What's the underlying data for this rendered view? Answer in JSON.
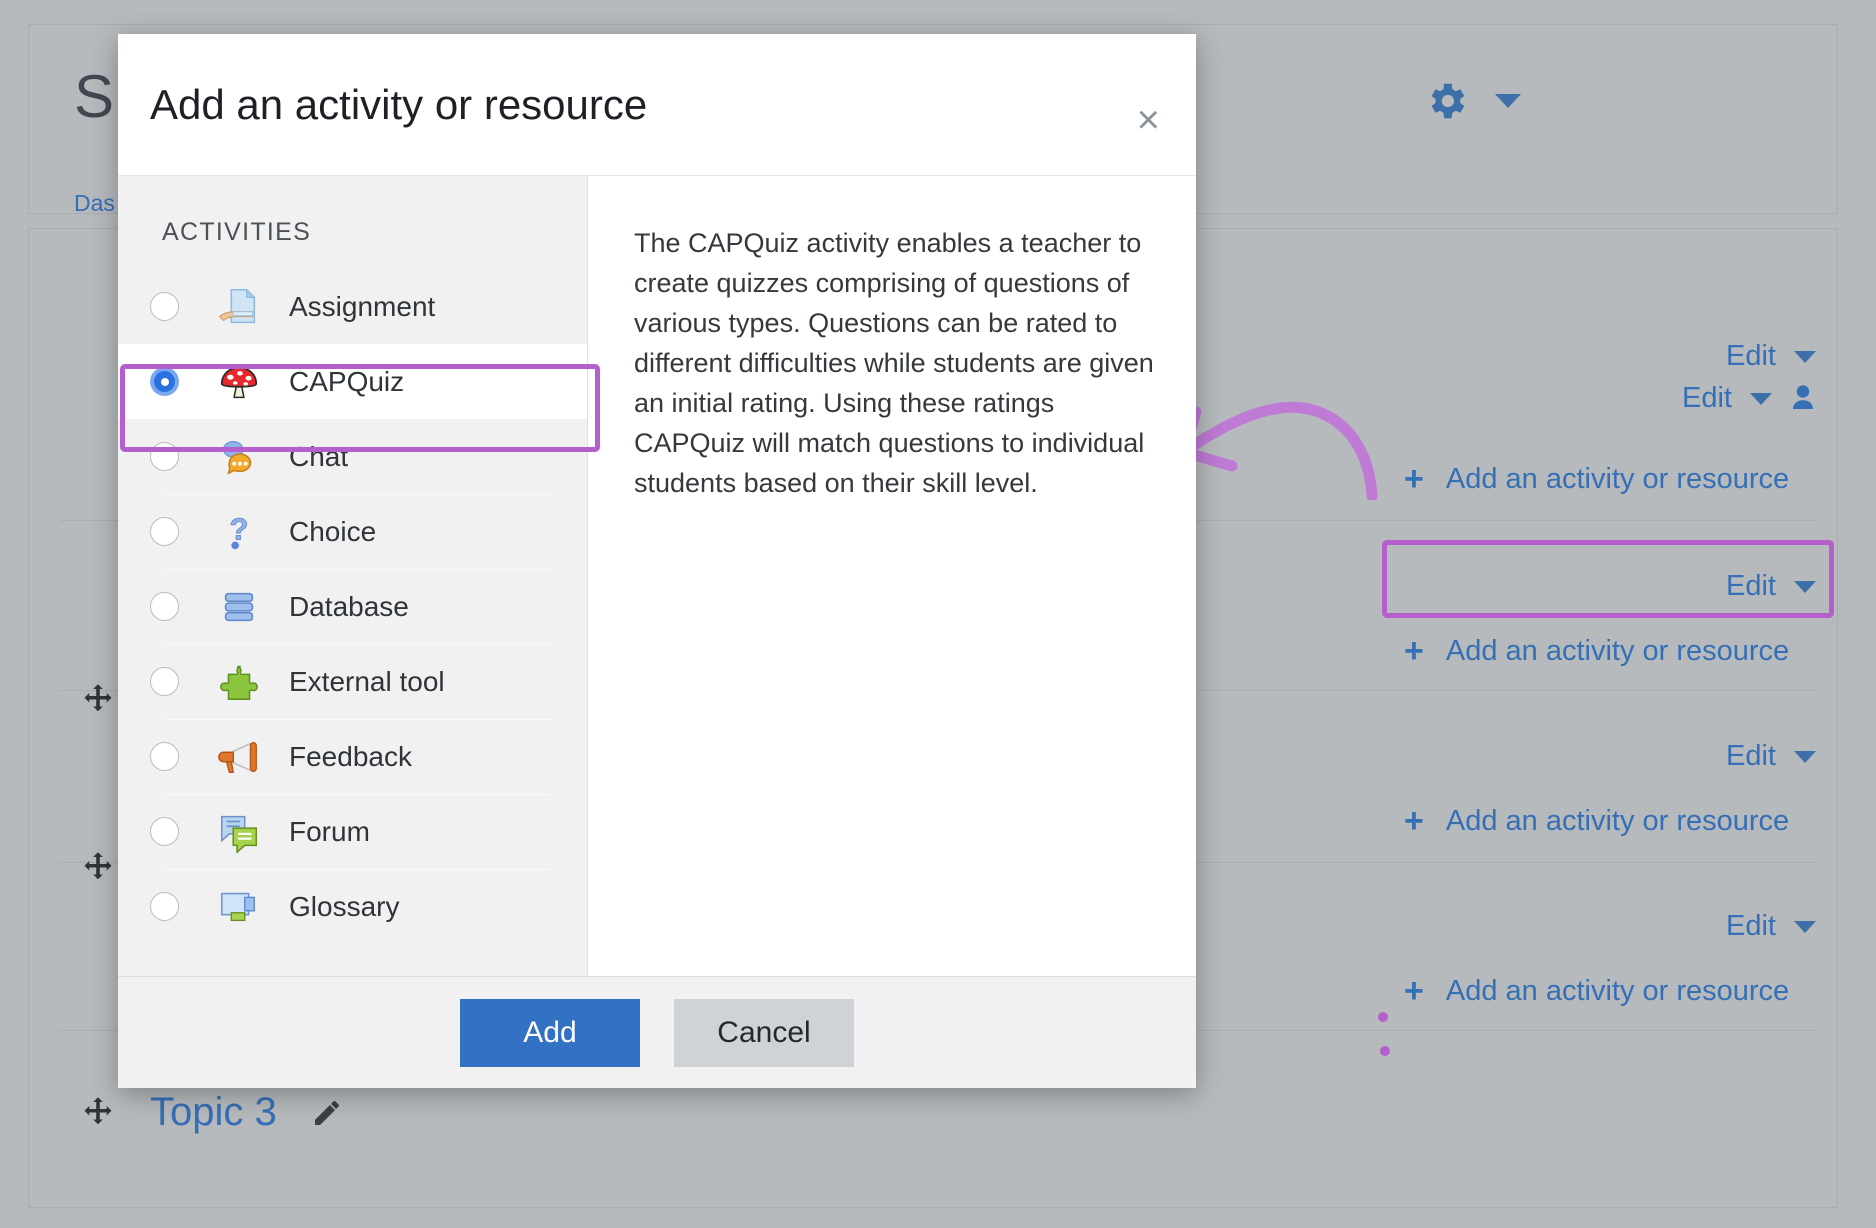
{
  "background": {
    "course_title": "S",
    "breadcrumb": "Das",
    "gear_icon": "gear-icon",
    "gear_caret_icon": "chevron-down-icon",
    "edit_rows": [
      {
        "label": "Edit",
        "caret_icon": "chevron-down-icon",
        "has_person": false
      },
      {
        "label": "Edit",
        "caret_icon": "chevron-down-icon",
        "has_person": true
      },
      {
        "label": "Edit",
        "caret_icon": "chevron-down-icon",
        "has_person": false
      },
      {
        "label": "Edit",
        "caret_icon": "chevron-down-icon",
        "has_person": false
      },
      {
        "label": "Edit",
        "caret_icon": "chevron-down-icon",
        "has_person": false
      }
    ],
    "add_links": [
      {
        "label": "Add an activity or resource",
        "icon": "plus-icon",
        "highlighted": true
      },
      {
        "label": "Add an activity or resource",
        "icon": "plus-icon",
        "highlighted": false
      },
      {
        "label": "Add an activity or resource",
        "icon": "plus-icon",
        "highlighted": false
      },
      {
        "label": "Add an activity or resource",
        "icon": "plus-icon",
        "highlighted": false
      }
    ],
    "topic": {
      "label": "Topic 3",
      "move_icon": "move-handle-icon",
      "edit_icon": "pencil-icon"
    }
  },
  "modal": {
    "title": "Add an activity or resource",
    "close_icon": "close-icon",
    "close_label": "×",
    "list_heading": "ACTIVITIES",
    "items": [
      {
        "label": "Assignment",
        "icon": "assignment-icon",
        "selected": false
      },
      {
        "label": "CAPQuiz",
        "icon": "mushroom-icon",
        "selected": true
      },
      {
        "label": "Chat",
        "icon": "chat-bubbles-icon",
        "selected": false
      },
      {
        "label": "Choice",
        "icon": "question-mark-icon",
        "selected": false
      },
      {
        "label": "Database",
        "icon": "database-icon",
        "selected": false
      },
      {
        "label": "External tool",
        "icon": "puzzle-piece-icon",
        "selected": false
      },
      {
        "label": "Feedback",
        "icon": "megaphone-icon",
        "selected": false
      },
      {
        "label": "Forum",
        "icon": "forum-icon",
        "selected": false
      },
      {
        "label": "Glossary",
        "icon": "glossary-icon",
        "selected": false
      }
    ],
    "description": "The CAPQuiz activity enables a teacher to create quizzes comprising of questions of various types. Questions can be rated to different difficulties while students are given an initial rating. Using these ratings CAPQuiz will match questions to individual students based on their skill level.",
    "add_label": "Add",
    "cancel_label": "Cancel"
  },
  "annotation": {
    "color": "#b55fcd",
    "arrow_icon": "curved-arrow-annotation",
    "highlight_boxes": 2
  }
}
